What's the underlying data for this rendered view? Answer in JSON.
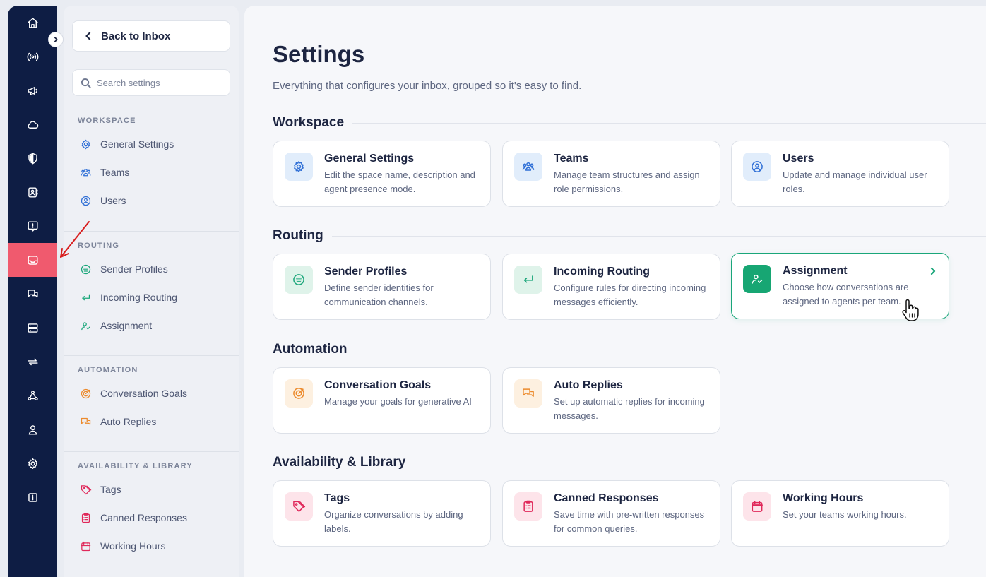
{
  "rail": {
    "items": [
      {
        "name": "home-icon"
      },
      {
        "name": "broadcast-icon"
      },
      {
        "name": "megaphone-icon"
      },
      {
        "name": "cloud-icon"
      },
      {
        "name": "shield-icon"
      },
      {
        "name": "contacts-icon"
      },
      {
        "name": "feedback-icon"
      },
      {
        "name": "inbox-icon",
        "active": true
      },
      {
        "name": "chat-icon"
      },
      {
        "name": "server-icon"
      },
      {
        "name": "sync-icon"
      },
      {
        "name": "webhook-icon"
      },
      {
        "name": "user-icon"
      },
      {
        "name": "gear-icon"
      },
      {
        "name": "info-icon"
      }
    ],
    "active_color": "#f05a6e",
    "background": "#0e1d44"
  },
  "sidebar": {
    "back_label": "Back to Inbox",
    "search_placeholder": "Search settings",
    "sections": [
      {
        "heading": "WORKSPACE",
        "items": [
          {
            "label": "General Settings",
            "icon": "gear-icon"
          },
          {
            "label": "Teams",
            "icon": "team-icon"
          },
          {
            "label": "Users",
            "icon": "user-circle-icon"
          }
        ]
      },
      {
        "heading": "ROUTING",
        "items": [
          {
            "label": "Sender Profiles",
            "icon": "sender-profile-icon"
          },
          {
            "label": "Incoming Routing",
            "icon": "enter-arrow-icon"
          },
          {
            "label": "Assignment",
            "icon": "user-check-icon"
          }
        ]
      },
      {
        "heading": "AUTOMATION",
        "items": [
          {
            "label": "Conversation Goals",
            "icon": "target-icon"
          },
          {
            "label": "Auto Replies",
            "icon": "chat-bubbles-icon"
          }
        ]
      },
      {
        "heading": "AVAILABILITY & LIBRARY",
        "items": [
          {
            "label": "Tags",
            "icon": "tag-icon"
          },
          {
            "label": "Canned Responses",
            "icon": "clipboard-icon"
          },
          {
            "label": "Working Hours",
            "icon": "calendar-icon"
          }
        ]
      }
    ]
  },
  "main": {
    "title": "Settings",
    "subtitle": "Everything that configures your inbox, grouped so it's easy to find.",
    "groups": [
      {
        "title": "Workspace",
        "cards": [
          {
            "title": "General Settings",
            "desc": "Edit the space name, description and agent presence mode.",
            "icon": "gear-icon"
          },
          {
            "title": "Teams",
            "desc": "Manage team structures and assign role permissions.",
            "icon": "team-icon"
          },
          {
            "title": "Users",
            "desc": "Update and manage individual user roles.",
            "icon": "user-circle-icon"
          }
        ]
      },
      {
        "title": "Routing",
        "cards": [
          {
            "title": "Sender Profiles",
            "desc": "Define sender identities for communication channels.",
            "icon": "sender-profile-icon"
          },
          {
            "title": "Incoming Routing",
            "desc": "Configure rules for directing incoming messages efficiently.",
            "icon": "enter-arrow-icon"
          },
          {
            "title": "Assignment",
            "desc": "Choose how conversations are assigned to agents per team.",
            "icon": "user-check-icon",
            "hovered": true
          }
        ]
      },
      {
        "title": "Automation",
        "cards": [
          {
            "title": "Conversation Goals",
            "desc": "Manage your goals for generative AI",
            "icon": "target-icon"
          },
          {
            "title": "Auto Replies",
            "desc": "Set up automatic replies for incoming messages.",
            "icon": "chat-bubbles-icon"
          }
        ]
      },
      {
        "title": "Availability & Library",
        "cards": [
          {
            "title": "Tags",
            "desc": "Organize conversations by adding labels.",
            "icon": "tag-icon"
          },
          {
            "title": "Canned Responses",
            "desc": "Save time with pre-written responses for common queries.",
            "icon": "clipboard-icon"
          },
          {
            "title": "Working Hours",
            "desc": "Set your teams working hours.",
            "icon": "calendar-icon"
          }
        ]
      }
    ]
  },
  "colors": {
    "accent_green": "#1aa67a",
    "accent_blue": "#2f6fd6",
    "accent_orange": "#ec8a2c",
    "accent_pink": "#e0285a"
  }
}
